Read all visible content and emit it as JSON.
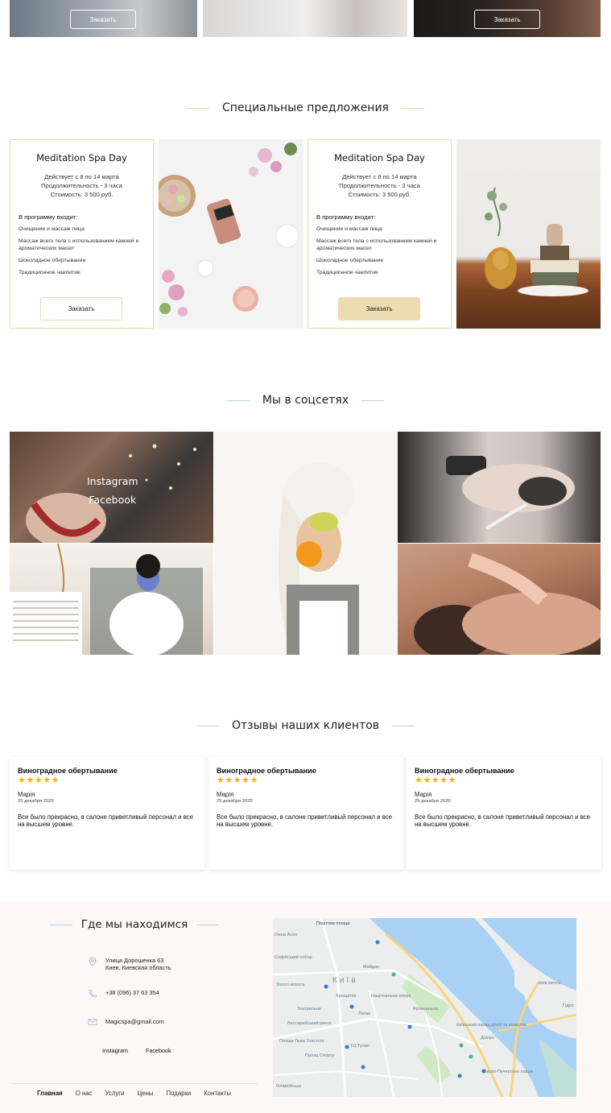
{
  "top_cards": {
    "order_label": "Заказать"
  },
  "offers_section": {
    "title": "Специальные предложения",
    "cards": [
      {
        "title": "Meditation Spa Day",
        "valid": "Действует с 8 по 14 марта",
        "duration": "Продолжительность  - 3 часа",
        "price": "Стоимость: 3 500 руб.",
        "includes_title": "В программу входит:",
        "items": [
          "Очищение и массаж лица",
          "Массаж всего тела с использованием камней и ароматических масел",
          "Шоколадное обертывание",
          "Традиционное чаепитие"
        ],
        "button": "Заказать"
      },
      {
        "title": "Meditation Spa Day",
        "valid": "Действует с 8 по 14 марта",
        "duration": "Продолжительность  - 3 часа",
        "price": "Стоимость: 3 500 руб.",
        "includes_title": "В программу входит:",
        "items": [
          "Очищение и массаж лица",
          "Массаж всего тела с использованием камней и ароматических масел",
          "Шоколадное обертывание",
          "Традиционное чаепитие"
        ],
        "button": "Заказать"
      }
    ]
  },
  "social_section": {
    "title": "Мы в соцсетях",
    "links": [
      "Instagram",
      "Facebook"
    ]
  },
  "reviews_section": {
    "title": "Отзывы наших клиентов",
    "reviews": [
      {
        "service": "Виноградное обертывание",
        "stars": "★★★★★",
        "author": "Марія",
        "date": "25 декабря 2020",
        "text": "Все было прекрасно, в салоне приветливый персонал и все на высшем уровне."
      },
      {
        "service": "Виноградное обертывание",
        "stars": "★★★★★",
        "author": "Марія",
        "date": "25 декабря 2020",
        "text": "Все было прекрасно, в салоне приветливый персонал и все на высшем уровне."
      },
      {
        "service": "Виноградное обертывание",
        "stars": "★★★★★",
        "author": "Марія",
        "date": "25 декабря 2020",
        "text": "Все было прекрасно, в салоне приветливый персонал и все на высшем уровне."
      }
    ]
  },
  "contacts": {
    "title": "Где мы находимся",
    "address_line1": "Улица Дорошенка 63",
    "address_line2": "Киев, Киевская область",
    "phone": "+38 (096) 37 63 354",
    "email": "Magicspa@gmail.com",
    "social": [
      "Instagram",
      "Facebook"
    ],
    "icons": {
      "address": "location-pin-icon",
      "phone": "phone-icon",
      "email": "mail-icon"
    }
  },
  "nav": [
    "Главная",
    "О нас",
    "Услуги",
    "Цены",
    "Подарки",
    "Контакты"
  ],
  "map": {
    "labels": {
      "city": "Київ",
      "poshtova": "Поштова площа",
      "asola": "Ожна Асоя",
      "sofia": "Софійський собор",
      "maidan": "Майдан",
      "zoloti": "Золоті ворота",
      "khreshchatyk": "Хрещатик",
      "teatralna": "Театральна",
      "opera": "Національна опера",
      "bessarabsky": "Бессарабський ринок",
      "lypky": "Липки",
      "tulip": "ТЦ Тулип",
      "arsenalna": "Арсенальна",
      "palats_sportu": "Палац Спорту",
      "lva_tolstogo": "Площа Льва Толстого",
      "kyiv_palace": "Київський палац дітей та юнацтва",
      "dnipro": "Дніпро",
      "vydubychi": "Видубичі",
      "lavra": "Києво-Печерська лавра",
      "olimpiiska": "Олімпійська",
      "kyiv_mechta": "Київ мечта",
      "hidropark": "Гідро"
    },
    "colors": {
      "water": "#a9d1f5",
      "land": "#eceded",
      "park": "#cfe9c5",
      "road": "#ffffff",
      "highway": "#f7d57a"
    }
  },
  "accent_colors": {
    "gold": "#e7d9a8",
    "gold_fill": "#ecdcb0",
    "blue_line": "#b9cfe4",
    "star": "#f4b400"
  }
}
